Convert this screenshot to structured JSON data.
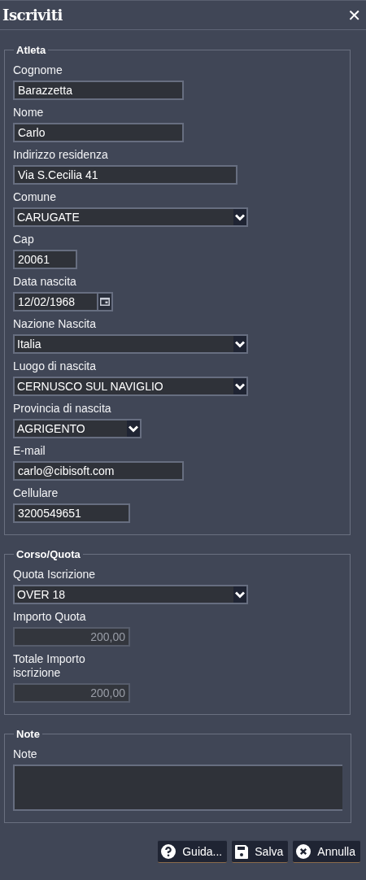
{
  "window": {
    "title": "Iscriviti",
    "close": "✕"
  },
  "sections": [
    {
      "title": "Atleta",
      "fields": [
        {
          "label": "Cognome",
          "kind": "text",
          "value": "Barazzetta",
          "disabled": false
        },
        {
          "label": "Nome",
          "kind": "text",
          "value": "Carlo",
          "disabled": false
        },
        {
          "label": "Indirizzo residenza",
          "kind": "text",
          "value": "Via S.Cecilia 41",
          "disabled": false
        },
        {
          "label": "Comune",
          "kind": "select",
          "value": "CARUGATE",
          "disabled": false
        },
        {
          "label": "Cap",
          "kind": "text",
          "value": "20061",
          "disabled": false
        },
        {
          "label": "Data nascita",
          "kind": "date",
          "value": "12/02/1968",
          "disabled": false
        },
        {
          "label": "Nazione Nascita",
          "kind": "select",
          "value": "Italia",
          "disabled": false
        },
        {
          "label": "Luogo di nascita",
          "kind": "select",
          "value": "CERNUSCO SUL NAVIGLIO",
          "disabled": false
        },
        {
          "label": "Provincia di nascita",
          "kind": "select",
          "value": "AGRIGENTO",
          "disabled": false
        },
        {
          "label": "E-mail",
          "kind": "text",
          "value": "carlo@cibisoft.com",
          "disabled": false
        },
        {
          "label": "Cellulare",
          "kind": "text",
          "value": "3200549651",
          "disabled": false
        }
      ]
    },
    {
      "title": "Corso/Quota",
      "fields": [
        {
          "label": "Quota Iscrizione",
          "kind": "select",
          "value": "OVER 18",
          "disabled": false
        },
        {
          "label": "Importo Quota",
          "kind": "text",
          "value": "200,00",
          "disabled": true
        },
        {
          "label": "Totale Importo iscrizione",
          "kind": "text",
          "value": "200,00",
          "disabled": true
        }
      ]
    },
    {
      "title": "Note",
      "fields": [
        {
          "label": "Note",
          "kind": "textarea",
          "disabled": false
        }
      ]
    }
  ],
  "buttons": [
    {
      "label": "Guida...",
      "kind": "help"
    },
    {
      "label": "Salva",
      "kind": "save"
    },
    {
      "label": "Annulla",
      "kind": "cancel"
    }
  ]
}
